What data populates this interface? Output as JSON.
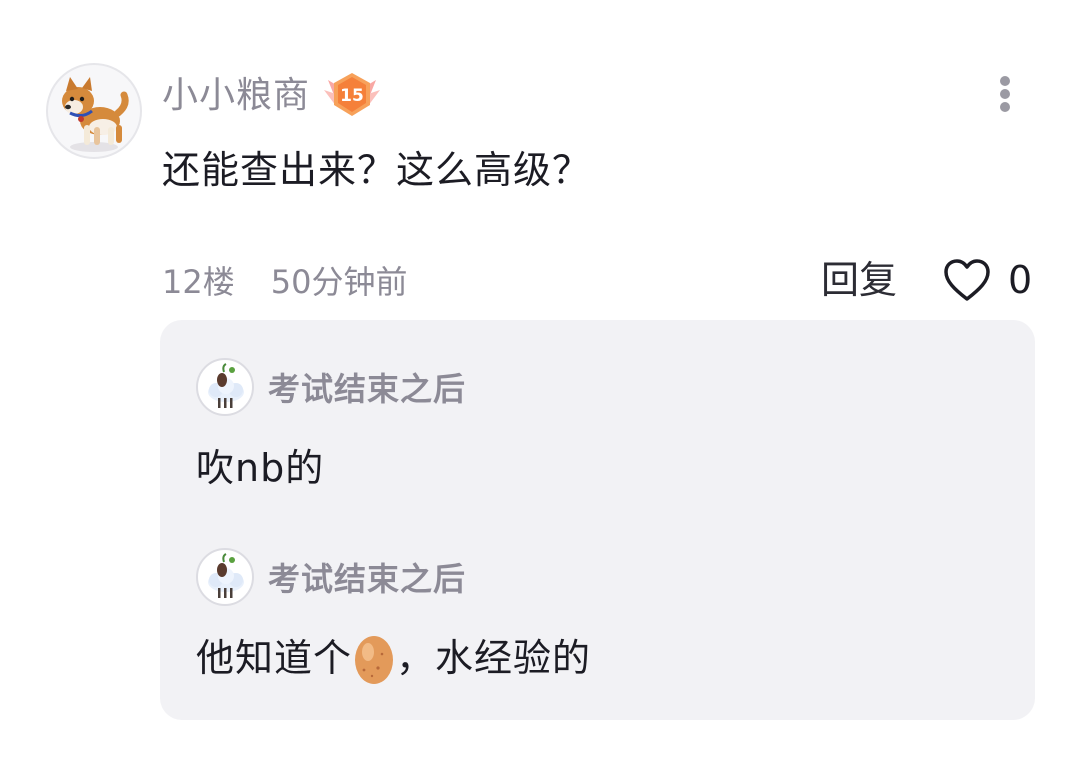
{
  "comment": {
    "username": "小小粮商",
    "level": "15",
    "text": "还能查出来？这么高级？",
    "floor": "12楼",
    "time": "50分钟前",
    "reply_label": "回复",
    "like_count": "0"
  },
  "replies": [
    {
      "username": "考试结束之后",
      "text": "吹nb的"
    },
    {
      "username": "考试结束之后",
      "text_before": "他知道个",
      "emoji": "egg",
      "text_after": "，水经验的"
    }
  ],
  "icons": {
    "more": "more-vertical-icon",
    "like": "heart-outline-icon",
    "level_badge": "winged-level-badge-icon",
    "emoji": "egg-emoji-icon"
  },
  "colors": {
    "badge_orange": "#f7803a",
    "badge_pink": "#f9a8a4",
    "reply_background": "#f2f2f5",
    "muted_text": "#8c8a96"
  }
}
